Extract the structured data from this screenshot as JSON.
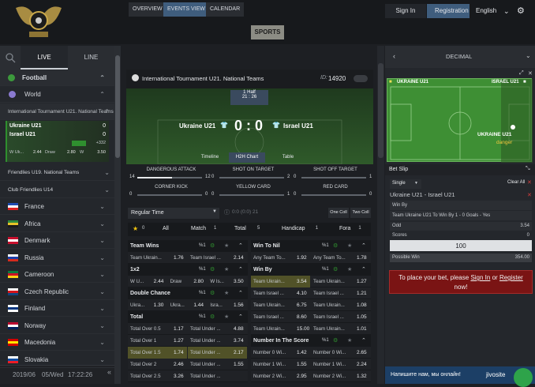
{
  "header": {
    "signin": "Sign In",
    "registration": "Registration",
    "language": "English",
    "sports": "SPORTS"
  },
  "left": {
    "tab_live": "LIVE",
    "tab_line": "LINE",
    "sport": "Football",
    "world": "World",
    "tournament1": "International Tournament U21. National Teams",
    "match": {
      "team1": "Ukraine U21",
      "team2": "Israel U21",
      "score1": "0",
      "score2": "0",
      "w1": "2.44",
      "draw_label": "Draw",
      "draw": "2.80",
      "w2_label": "W",
      "w2": "3.50",
      "more": "+332",
      "w1_prefix": "W Uk..."
    },
    "tournament2": "Friendlies U19. National Teams",
    "tournament3": "Club Friendlies U14",
    "countries": [
      "France",
      "Africa",
      "Denmark",
      "Russia",
      "Cameroon",
      "Czech Republic",
      "Finland",
      "Norway",
      "Macedonia",
      "Slovakia"
    ],
    "date": "2019/06",
    "day": "05/Wed",
    "time": "17:22:26"
  },
  "center": {
    "tabs": [
      "OVERVIEW",
      "EVENTS VIEW",
      "CALENDAR"
    ],
    "event_title": "International Tournament U21. National Teams",
    "id_label": "ID:",
    "id_value": "14920",
    "period": "1 Half",
    "clock": "21 : 26",
    "team1": "Ukraine U21",
    "team2": "Israel U21",
    "score": "0 : 0",
    "subtabs": [
      "Timeline",
      "H2H Chart",
      "Table"
    ],
    "stats": [
      {
        "label": "DANGEROUS ATTACK",
        "a": "14",
        "b": "12"
      },
      {
        "label": "SHOT ON TARGET",
        "a": "0",
        "b": "2"
      },
      {
        "label": "SHOT OFF TARGET",
        "a": "0",
        "b": "1"
      },
      {
        "label": "CORNER KICK",
        "a": "0",
        "b": "0"
      },
      {
        "label": "YELLOW CARD",
        "a": "0",
        "b": "1"
      },
      {
        "label": "RED CARD",
        "a": "0",
        "b": "0"
      }
    ],
    "regular_time": "Regular Time",
    "reg_score": "0:0 (0:0) 21",
    "one_coll": "One Coll",
    "two_coll": "Two Coll",
    "filters": [
      {
        "label": "All",
        "count": ""
      },
      {
        "label": "Match",
        "count": "1"
      },
      {
        "label": "Total",
        "count": "5"
      },
      {
        "label": "Handicap",
        "count": "1"
      },
      {
        "label": "Fora",
        "count": "1"
      }
    ],
    "fav_count": "0",
    "left_markets": [
      {
        "title": "Team Wins",
        "rows": [
          [
            "Team Ukrain...",
            "1.76",
            "Team Israel ...",
            "2.14"
          ]
        ]
      },
      {
        "title": "1x2",
        "rows": [
          [
            "W U...",
            "2.44",
            "Draw",
            "2.80",
            "W Is...",
            "3.50"
          ]
        ]
      },
      {
        "title": "Double Chance",
        "rows": [
          [
            "Ukra...",
            "1.30",
            "Ukra...",
            "1.44",
            "Isra...",
            "1.56"
          ]
        ]
      },
      {
        "title": "Total",
        "rows": [
          [
            "Total Over 0.5",
            "1.17",
            "Total Under ...",
            "4.88"
          ],
          [
            "Total Over 1",
            "1.27",
            "Total Under ...",
            "3.74"
          ],
          [
            "Total Over 1.5",
            "1.74",
            "Total Under ...",
            "2.17"
          ],
          [
            "Total Over 2",
            "2.46",
            "Total Under ...",
            "1.55"
          ],
          [
            "Total Over 2.5",
            "3.26",
            "Total Under ...",
            ""
          ]
        ]
      }
    ],
    "right_markets": [
      {
        "title": "Win To Nil",
        "rows": [
          [
            "Any Team To...",
            "1.92",
            "Any Team To...",
            "1.78"
          ]
        ]
      },
      {
        "title": "Win By",
        "rows": [
          [
            "Team Ukrain...",
            "3.54",
            "Team Ukrain...",
            "1.27"
          ],
          [
            "Team Israel ...",
            "4.10",
            "Team Israel ...",
            "1.21"
          ],
          [
            "Team Ukrain...",
            "6.75",
            "Team Ukrain...",
            "1.08"
          ],
          [
            "Team Israel ...",
            "8.60",
            "Team Israel ...",
            "1.05"
          ],
          [
            "Team Ukrain...",
            "15.00",
            "Team Ukrain...",
            "1.01"
          ]
        ]
      },
      {
        "title": "Number In The Score",
        "rows": [
          [
            "Number 0 Wi...",
            "1.42",
            "Number 0 Wi...",
            "2.65"
          ],
          [
            "Number 1 Wi...",
            "1.55",
            "Number 1 Wi...",
            "2.24"
          ],
          [
            "Number 2 Wi...",
            "2.95",
            "Number 2 Wi...",
            "1.32"
          ]
        ]
      }
    ]
  },
  "right": {
    "odds_format": "DECIMAL",
    "pitch_team1": "UKRAINE U21",
    "pitch_team2": "ISRAEL U21",
    "pitch_team": "UKRAINE U21",
    "pitch_state": "danger",
    "betslip": "Bet Slip",
    "single": "Single",
    "clear_all": "Clear All",
    "match": "Ukraine U21 - Israel U21",
    "market": "Win By",
    "selection": "Team Ukraine U21 To Win By 1 - 0 Goals - Yes",
    "odd_label": "Odd",
    "odd_value": "3.54",
    "scores_label": "Scores",
    "scores_value": "0",
    "stake": "100",
    "possible_label": "Possible Win",
    "possible_value": "354.00",
    "place_pre": "To place your bet, please",
    "signin": "Sign In",
    "or": "or",
    "register": "Register",
    "now": "now!",
    "chat": "Напишите нам, мы онлайн!",
    "chat_brand": "jivosite"
  },
  "colors": {
    "accent_blue": "#3f5d7d",
    "selected": "#515228",
    "green": "#2d6e2d",
    "red": "#7a1414"
  }
}
